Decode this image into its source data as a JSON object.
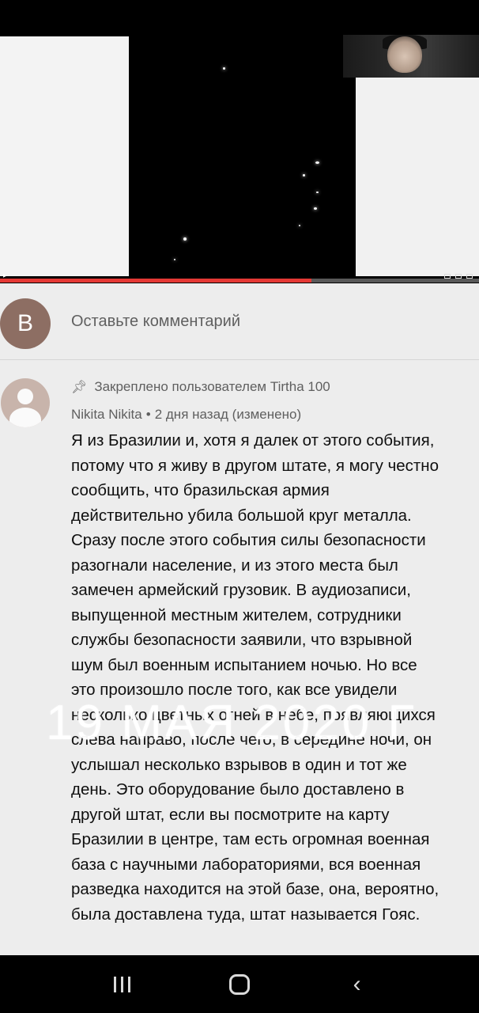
{
  "comment_box": {
    "avatar_letter": "B",
    "placeholder": "Оставьте комментарий"
  },
  "comment": {
    "pinned_label": "Закреплено пользователем Tirtha 100",
    "author": "Nikita Nikita",
    "separator": "•",
    "time": "2 дня назад (изменено)",
    "lines": [
      "Я из Бразилии и, хотя я далек от этого события,",
      "потому что я живу в другом штате, я могу честно",
      "сообщить, что бразильская армия",
      "действительно убила большой круг металла.",
      "Сразу после этого события силы безопасности",
      "разогнали население, и из этого места был",
      "замечен армейский грузовик. В аудиозаписи,",
      "выпущенной местным жителем, сотрудники",
      "службы безопасности заявили, что взрывной",
      "шум был военным испытанием ночью. Но все",
      "это произошло после того, как все увидели",
      "несколько цветных огней в небе, появляющихся",
      "слева направо, после чего, в середине ночи, он",
      "услышал несколько взрывов в один и тот же",
      "день. Это оборудование было доставлено в",
      "другой штат, если вы посмотрите на карту",
      "Бразилии в центре, там есть огромная военная",
      "база с научными лабораториями, вся военная",
      "разведка находится на этой базе, она, вероятно,",
      "была доставлена туда, штат называется Гояс."
    ]
  },
  "watermark": "19 МАЯ 2020 Г",
  "video": {
    "progress": 0.65
  },
  "icons": {
    "pin": "pin-icon",
    "recents": "recents-icon",
    "home": "home-icon",
    "back": "back-icon"
  },
  "colors": {
    "progress": "#e53935",
    "avatar_b": "#8d6e63",
    "avatar_user": "#c8b4ab",
    "background": "#ededed"
  }
}
